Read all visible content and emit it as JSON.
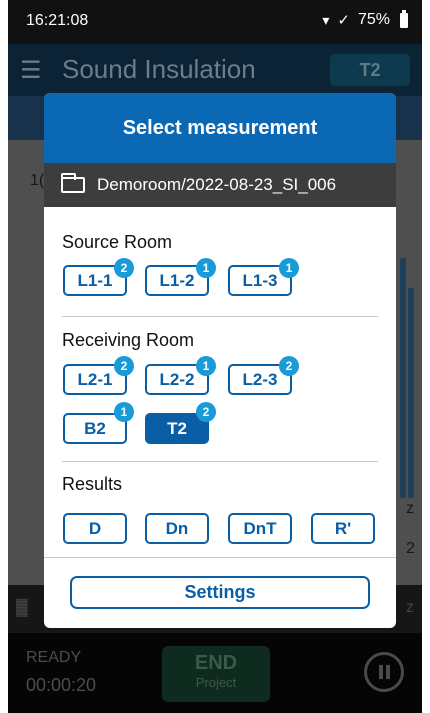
{
  "status_bar": {
    "time": "16:21:08",
    "battery": "75%"
  },
  "app_bar": {
    "title": "Sound Insulation",
    "chip": "T2"
  },
  "background": {
    "partial_left_1": "1(",
    "partial_right_1": "z",
    "partial_right_2": "2",
    "partial_right_3": "z"
  },
  "footer": {
    "status": "READY",
    "timer": "00:00:20",
    "end_label": "END",
    "end_sub": "Project"
  },
  "dialog": {
    "title": "Select measurement",
    "path": "Demoroom/2022-08-23_SI_006",
    "source_room": {
      "title": "Source Room",
      "items": [
        {
          "label": "L1-1",
          "count": "2"
        },
        {
          "label": "L1-2",
          "count": "1"
        },
        {
          "label": "L1-3",
          "count": "1"
        }
      ]
    },
    "receiving_room": {
      "title": "Receiving Room",
      "items": [
        {
          "label": "L2-1",
          "count": "2"
        },
        {
          "label": "L2-2",
          "count": "1"
        },
        {
          "label": "L2-3",
          "count": "2"
        },
        {
          "label": "B2",
          "count": "1"
        },
        {
          "label": "T2",
          "count": "2",
          "selected": true
        }
      ]
    },
    "results": {
      "title": "Results",
      "items": [
        {
          "label": "D"
        },
        {
          "label": "Dn"
        },
        {
          "label": "DnT"
        },
        {
          "label": "R'"
        }
      ]
    },
    "settings_label": "Settings"
  },
  "colors": {
    "primary": "#0a68b4",
    "badge": "#199bd7",
    "header_dark": "#3d3d3d"
  }
}
